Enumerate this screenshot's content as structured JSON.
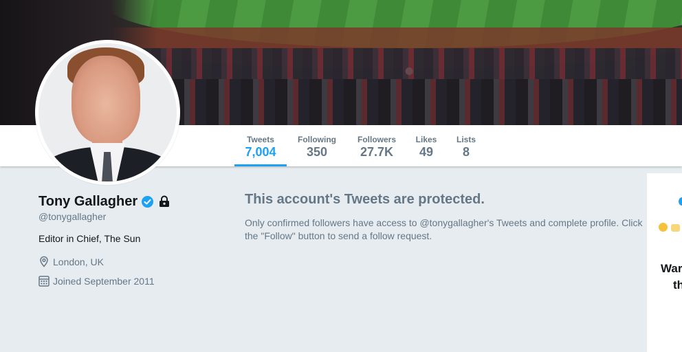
{
  "nav": {
    "items": [
      {
        "label": "Tweets",
        "value": "7,004",
        "active": true
      },
      {
        "label": "Following",
        "value": "350"
      },
      {
        "label": "Followers",
        "value": "27.7K"
      },
      {
        "label": "Likes",
        "value": "49"
      },
      {
        "label": "Lists",
        "value": "8"
      }
    ]
  },
  "profile": {
    "name": "Tony Gallagher",
    "handle": "@tonygallagher",
    "bio": "Editor in Chief, The Sun",
    "location": "London, UK",
    "joined": "Joined September 2011"
  },
  "protected": {
    "title": "This account's Tweets are protected.",
    "text": "Only confirmed followers have access to @tonygallagher's Tweets and complete profile. Click the \"Follow\" button to send a follow request."
  },
  "right_card": {
    "line1": "War",
    "line2": "th"
  },
  "colors": {
    "accent": "#1da1f2",
    "muted": "#657786",
    "background": "#e6ecf0"
  }
}
